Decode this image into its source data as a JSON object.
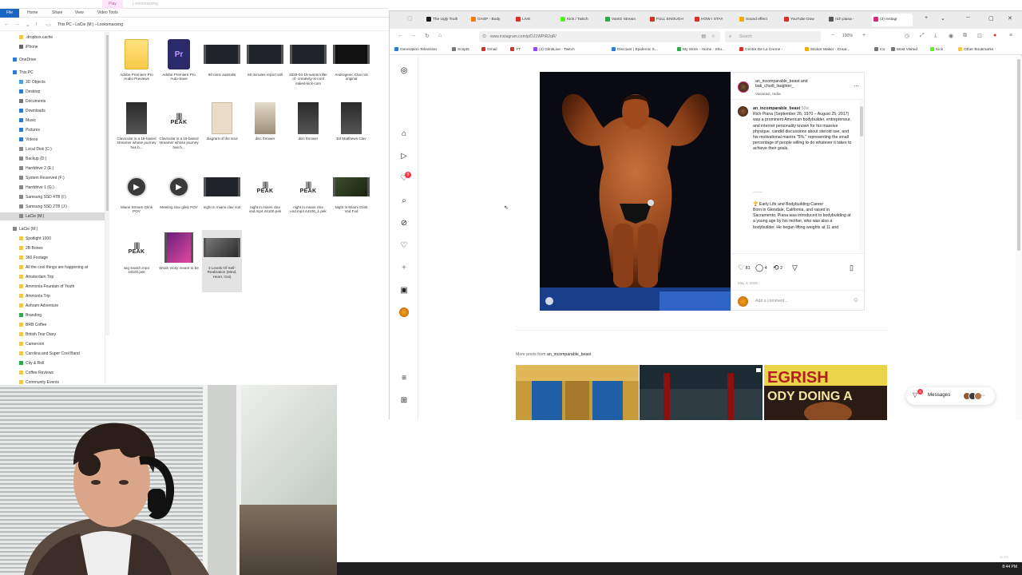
{
  "explorer": {
    "ribbon_tabs": [
      "File",
      "Home",
      "Share",
      "View",
      "Video Tools"
    ],
    "manage_tab": "Play",
    "title": "Looksmaxxing",
    "path": [
      "This PC",
      "LaCie (M:)",
      "Looksmaxxing"
    ],
    "nav_items": [
      ".dropbox.cache",
      "iPhone",
      "OneDrive",
      "This PC",
      "3D Objects",
      "Desktop",
      "Documents",
      "Downloads",
      "Music",
      "Pictures",
      "Videos",
      "Local Disk (C:)",
      "Backup (D:)",
      "Harddrive 2 (E:)",
      "System Reserved (F:)",
      "Harddrive 1 (G:)",
      "Samsung SSD 4TB (I:)",
      "Samsung SSD 2TB (J:)",
      "LaCie (M:)",
      "LaCie (M:)",
      "Spotlight 1000",
      "2B Bones",
      "360 Footage",
      "All the cool things are happening at",
      "Amsterdam Trip",
      "Ammonia Fountain of Youth",
      "Ammonia Trip",
      "Ashram Adventure",
      "Branding",
      "BRB Coffee",
      "British Tour Diary",
      "Cameroon",
      "Carolina and Super Cool Band",
      "City & Roll",
      "Coffee Reviews",
      "Community Events"
    ],
    "files": [
      {
        "label": "Adobe Premiere Pro Audio Previews",
        "kind": "folder"
      },
      {
        "label": "Adobe Premiere Pro Auto-Save",
        "kind": "premiere"
      },
      {
        "label": "60 mins australis",
        "kind": "video"
      },
      {
        "label": "60 minutes report still",
        "kind": "video"
      },
      {
        "label": "2026-04-15-wants killer of -creativity-is-cool naked-kick-com",
        "kind": "video"
      },
      {
        "label": "Androgenic Clav not original",
        "kind": "video"
      },
      {
        "label": "Clavicular is a 19-based streamer whose journey has b...",
        "kind": "tall"
      },
      {
        "label": "Clavicular is a 19-based streamer whose journey has b...",
        "kind": "peak"
      },
      {
        "label": "diagram of the soul",
        "kind": "paper"
      },
      {
        "label": "disc thrower",
        "kind": "statue"
      },
      {
        "label": "disc thrower",
        "kind": "tall"
      },
      {
        "label": "Ed Matthews Clav",
        "kind": "tall"
      },
      {
        "label": "Miami Stream Glink POV",
        "kind": "play"
      },
      {
        "label": "Meeting clav glink POV",
        "kind": "play"
      },
      {
        "label": "night in miami clav vod",
        "kind": "video"
      },
      {
        "label": "night in miami clav vod.mp4 44100.pek",
        "kind": "peak"
      },
      {
        "label": "night in miami clav vod.mp4 44100_1.pek",
        "kind": "peak"
      },
      {
        "label": "Night in Miami Glink Vod Fxd",
        "kind": "video"
      },
      {
        "label": "wig snatch.mp4 44100.pek",
        "kind": "peak"
      },
      {
        "label": "Woah Vicky meant to be",
        "kind": "purple"
      },
      {
        "label": "3 Levels Of Self-Realization (Mind, Heart, Gut)",
        "kind": "video_sel"
      }
    ]
  },
  "browser": {
    "tabs": [
      "The Ugly Truth",
      "GASP - Body",
      "LIVE",
      "Kick / Twitch",
      "VantG Stream",
      "FULL ENOUGH",
      "HOW I STAY",
      "Sound effect",
      "YouTube Dow",
      "rich piana -",
      "(3) Instagr"
    ],
    "url": "www.instagram.com/p/DJ1WPtR2qR/",
    "search_placeholder": "Search",
    "zoom": "100%",
    "bookmarks": [
      "Generation Television",
      "Scripts",
      "Gmail",
      "YT",
      "(4) GlinkLive - Twitch",
      "Discover | Epidemic S...",
      "My Store - Home - Sho...",
      "Centre De La Creme -",
      "Sticker Maker - Creat...",
      "Ico",
      "Most Visited",
      "Kick",
      "Other Bookmarks"
    ]
  },
  "instagram": {
    "notification_count": "9",
    "post": {
      "users": "an_incomparable_beast and bak_chodi_laughter_",
      "location": "Varanasi, India",
      "caption_user": "an_incomparable_beast",
      "caption_time": "50w",
      "caption": "Rich Piana (September 26, 1970 – August 25, 2017) was a prominent American bodybuilder, entrepreneur, and internet personality known for his massive physique, candid discussions about steroid use, and his motivational mantra \"5%,\" representing the small percentage of people willing to do whatever it takes to achieve their goals. ",
      "separator": "⸻",
      "section_title": "Early Life and Bodybuilding Career",
      "section_text": "Born in Glendale, California, and raised in Sacramento, Piana was introduced to bodybuilding at a young age by his mother, who was also a bodybuilder. He began lifting weights at 11 and",
      "likes": "81",
      "comments": "4",
      "reposts": "2",
      "date": "May 4, 2025",
      "comment_placeholder": "Add a comment..."
    },
    "more_posts_prefix": "More posts from",
    "more_posts_user": "an_incomparable_beast",
    "messages_label": "Messages",
    "messages_badge": "9"
  },
  "taskbar": {
    "clock": "8:44 PM"
  },
  "colors": {
    "accent": "#1a66c2",
    "instagram_red": "#ff3040",
    "taskbar": "#1f1f1f"
  }
}
